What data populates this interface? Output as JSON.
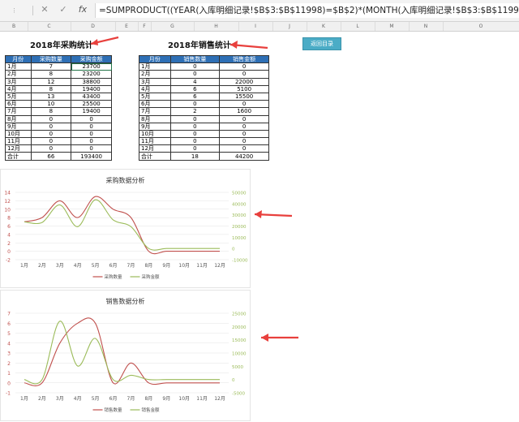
{
  "formula_bar": {
    "name_box": "",
    "cancel_icon": "✕",
    "enter_icon": "✓",
    "fx_label": "fx",
    "formula": "=SUMPRODUCT((YEAR(入库明细记录!$B$3:$B$11998)=$B$2)*(MONTH(入库明细记录!$B$3:$B$11998)=B5)*入库明细记录!$L$3:$"
  },
  "columns": [
    "B",
    "C",
    "D",
    "E",
    "F",
    "G",
    "H",
    "I",
    "J",
    "K",
    "L",
    "M",
    "N",
    "O"
  ],
  "purchase": {
    "title": "2018年采购统计",
    "headers": [
      "月份",
      "采购数量",
      "采购金额"
    ],
    "rows": [
      [
        "1月",
        "7",
        "23700"
      ],
      [
        "2月",
        "8",
        "23200"
      ],
      [
        "3月",
        "12",
        "38800"
      ],
      [
        "4月",
        "8",
        "19400"
      ],
      [
        "5月",
        "13",
        "43400"
      ],
      [
        "6月",
        "10",
        "25500"
      ],
      [
        "7月",
        "8",
        "19400"
      ],
      [
        "8月",
        "0",
        "0"
      ],
      [
        "9月",
        "0",
        "0"
      ],
      [
        "10月",
        "0",
        "0"
      ],
      [
        "11月",
        "0",
        "0"
      ],
      [
        "12月",
        "0",
        "0"
      ],
      [
        "合计",
        "66",
        "193400"
      ]
    ]
  },
  "sales": {
    "title": "2018年销售统计",
    "headers": [
      "月份",
      "销售数量",
      "销售金额"
    ],
    "rows": [
      [
        "1月",
        "0",
        "0"
      ],
      [
        "2月",
        "0",
        "0"
      ],
      [
        "3月",
        "4",
        "22000"
      ],
      [
        "4月",
        "6",
        "5100"
      ],
      [
        "5月",
        "6",
        "15500"
      ],
      [
        "6月",
        "0",
        "0"
      ],
      [
        "7月",
        "2",
        "1600"
      ],
      [
        "8月",
        "0",
        "0"
      ],
      [
        "9月",
        "0",
        "0"
      ],
      [
        "10月",
        "0",
        "0"
      ],
      [
        "11月",
        "0",
        "0"
      ],
      [
        "12月",
        "0",
        "0"
      ],
      [
        "合计",
        "18",
        "44200"
      ]
    ]
  },
  "back_button": "返回目录",
  "colors": {
    "qty": "#c0504d",
    "amt": "#9bbb59",
    "header": "#2e6fb5",
    "arrow": "#e8403d",
    "button": "#4bacc6"
  },
  "chart_data": [
    {
      "type": "line",
      "title": "采购数据分析",
      "categories": [
        "1月",
        "2月",
        "3月",
        "4月",
        "5月",
        "6月",
        "7月",
        "8月",
        "9月",
        "10月",
        "11月",
        "12月"
      ],
      "series": [
        {
          "name": "采购数量",
          "axis": "left",
          "values": [
            7,
            8,
            12,
            8,
            13,
            10,
            8,
            0,
            0,
            0,
            0,
            0
          ]
        },
        {
          "name": "采购金额",
          "axis": "right",
          "values": [
            23700,
            23200,
            38800,
            19400,
            43400,
            25500,
            19400,
            0,
            0,
            0,
            0,
            0
          ]
        }
      ],
      "ylim_left": [
        -2,
        14
      ],
      "yticks_left": [
        -2,
        0,
        2,
        4,
        6,
        8,
        10,
        12,
        14
      ],
      "ylim_right": [
        -10000,
        50000
      ],
      "yticks_right": [
        -10000,
        0,
        10000,
        20000,
        30000,
        40000,
        50000
      ],
      "ytick_labels_right": [
        "-10000",
        "0",
        "10000",
        "20000",
        "30000",
        "40000",
        "50000"
      ],
      "smooth": true,
      "grid": true,
      "legend": "bottom"
    },
    {
      "type": "line",
      "title": "销售数据分析",
      "categories": [
        "1月",
        "2月",
        "3月",
        "4月",
        "5月",
        "6月",
        "7月",
        "8月",
        "9月",
        "10月",
        "11月",
        "12月"
      ],
      "series": [
        {
          "name": "销售数量",
          "axis": "left",
          "values": [
            0,
            0,
            4,
            6,
            6,
            0,
            2,
            0,
            0,
            0,
            0,
            0
          ]
        },
        {
          "name": "销售金额",
          "axis": "right",
          "values": [
            0,
            0,
            22000,
            5100,
            15500,
            0,
            1600,
            0,
            0,
            0,
            0,
            0
          ]
        }
      ],
      "ylim_left": [
        -1,
        7
      ],
      "yticks_left": [
        -1,
        0,
        1,
        2,
        3,
        4,
        5,
        6,
        7
      ],
      "ylim_right": [
        -5000,
        25000
      ],
      "yticks_right": [
        -5000,
        0,
        5000,
        10000,
        15000,
        20000,
        25000
      ],
      "ytick_labels_right": [
        "-5000",
        "0",
        "5000",
        "10000",
        "15000",
        "20000",
        "25000"
      ],
      "smooth": true,
      "grid": true,
      "legend": "bottom"
    }
  ]
}
